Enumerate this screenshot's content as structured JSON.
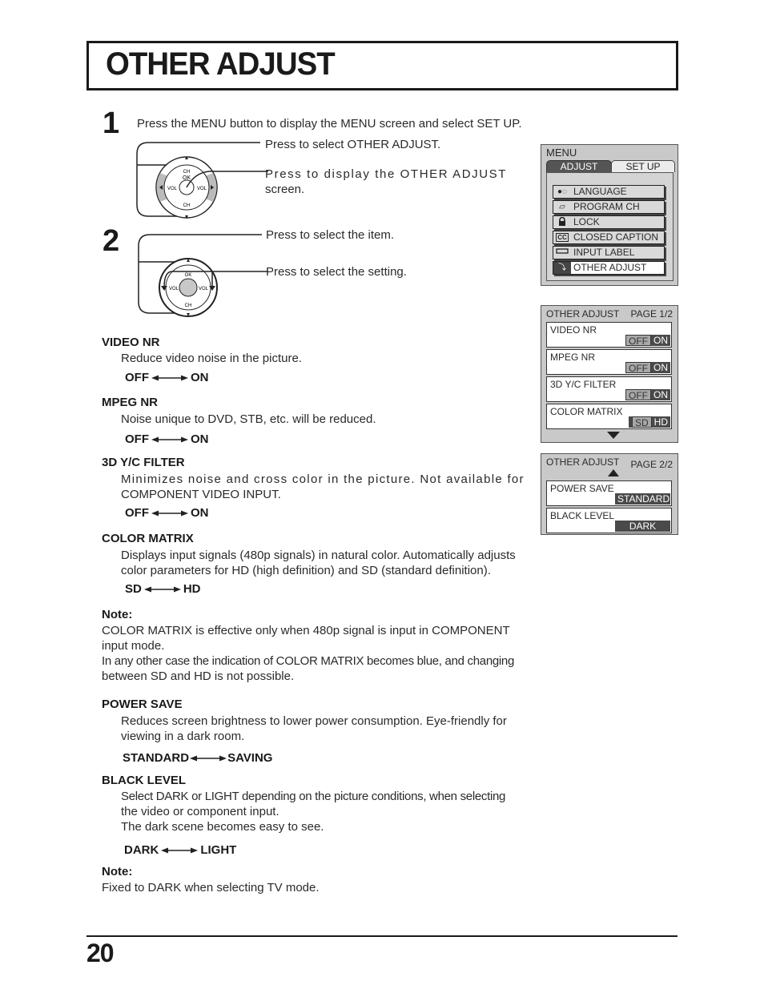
{
  "page": {
    "title": "OTHER ADJUST",
    "page_number": "20"
  },
  "steps": [
    {
      "number": "1",
      "instruction": "Press the MENU button to display the MENU screen and select SET UP.",
      "callouts": [
        "Press to select OTHER ADJUST.",
        "Press to display the OTHER ADJUST",
        "screen."
      ]
    },
    {
      "number": "2",
      "callouts": [
        "Press to select the item.",
        "Press to select the setting."
      ]
    }
  ],
  "remote": {
    "labels": {
      "ch": "CH",
      "ok": "OK",
      "vol": "VOL"
    }
  },
  "sections": [
    {
      "heading": "VIDEO NR",
      "description": [
        "Reduce video noise in the picture."
      ],
      "options": [
        "OFF",
        "ON"
      ]
    },
    {
      "heading": "MPEG NR",
      "description": [
        "Noise unique to DVD, STB, etc. will be reduced."
      ],
      "options": [
        "OFF",
        "ON"
      ]
    },
    {
      "heading": "3D Y/C FILTER",
      "description": [
        "Minimizes noise and cross color in the picture. Not available for",
        "COMPONENT VIDEO INPUT."
      ],
      "options": [
        "OFF",
        "ON"
      ]
    },
    {
      "heading": "COLOR MATRIX",
      "description": [
        "Displays input signals (480p signals) in natural color. Automatically adjusts",
        "color parameters for HD (high definition) and SD (standard definition)."
      ],
      "options": [
        "SD",
        "HD"
      ]
    },
    {
      "heading": "POWER SAVE",
      "description": [
        "Reduces screen brightness to lower power consumption. Eye-friendly for",
        "viewing in a dark room."
      ],
      "options": [
        "STANDARD",
        "SAVING"
      ]
    },
    {
      "heading": "BLACK LEVEL",
      "description": [
        "Select DARK or LIGHT depending on the picture conditions, when selecting",
        "the video or component input.",
        "The dark scene becomes easy to see."
      ],
      "options": [
        "DARK",
        "LIGHT"
      ]
    }
  ],
  "notes": [
    {
      "label": "Note:",
      "lines": [
        "COLOR MATRIX is effective only when 480p signal is input in COMPONENT",
        "input mode.",
        "In any other case the indication of COLOR MATRIX becomes blue, and changing",
        "between SD and HD is not possible."
      ]
    },
    {
      "label": "Note:",
      "lines": [
        "Fixed to DARK when selecting TV mode."
      ]
    }
  ],
  "menu_screen": {
    "title": "MENU",
    "tabs": [
      {
        "label": "ADJUST",
        "active": true
      },
      {
        "label": "SET  UP",
        "active": false
      }
    ],
    "items": [
      {
        "icon": "language-icon",
        "glyph": "❶◌",
        "label": "LANGUAGE"
      },
      {
        "icon": "program-ch-icon",
        "glyph": "▭",
        "label": "PROGRAM  CH"
      },
      {
        "icon": "lock-icon",
        "glyph": "🔒",
        "label": "LOCK"
      },
      {
        "icon": "closed-caption-icon",
        "glyph": "CC",
        "label": "CLOSED  CAPTION"
      },
      {
        "icon": "input-label-icon",
        "glyph": "▭",
        "label": "INPUT  LABEL"
      },
      {
        "icon": "other-adjust-icon",
        "glyph": "⤵",
        "label": "OTHER  ADJUST",
        "selected": true
      }
    ]
  },
  "other_adjust_page1": {
    "title": "OTHER  ADJUST",
    "page": "PAGE 1/2",
    "items": [
      {
        "label": "VIDEO NR",
        "options": [
          "OFF",
          "ON"
        ],
        "selected": "ON"
      },
      {
        "label": "MPEG NR",
        "options": [
          "OFF",
          "ON"
        ],
        "selected": "ON"
      },
      {
        "label": "3D Y/C FILTER",
        "options": [
          "OFF",
          "ON"
        ],
        "selected": "ON"
      },
      {
        "label": "COLOR  MATRIX",
        "options": [
          "SD",
          "HD"
        ],
        "selected": "HD"
      }
    ]
  },
  "other_adjust_page2": {
    "title": "OTHER  ADJUST",
    "page": "PAGE 2/2",
    "items": [
      {
        "label": "POWER SAVE",
        "value": "STANDARD"
      },
      {
        "label": "BLACK LEVEL",
        "value": "DARK"
      }
    ]
  },
  "colors": {
    "panel_bg": "#c9c9c9",
    "selected_segment": "#4a4a4a",
    "unselected_segment": "#a8a8a8",
    "text": "#1a1a1a"
  }
}
